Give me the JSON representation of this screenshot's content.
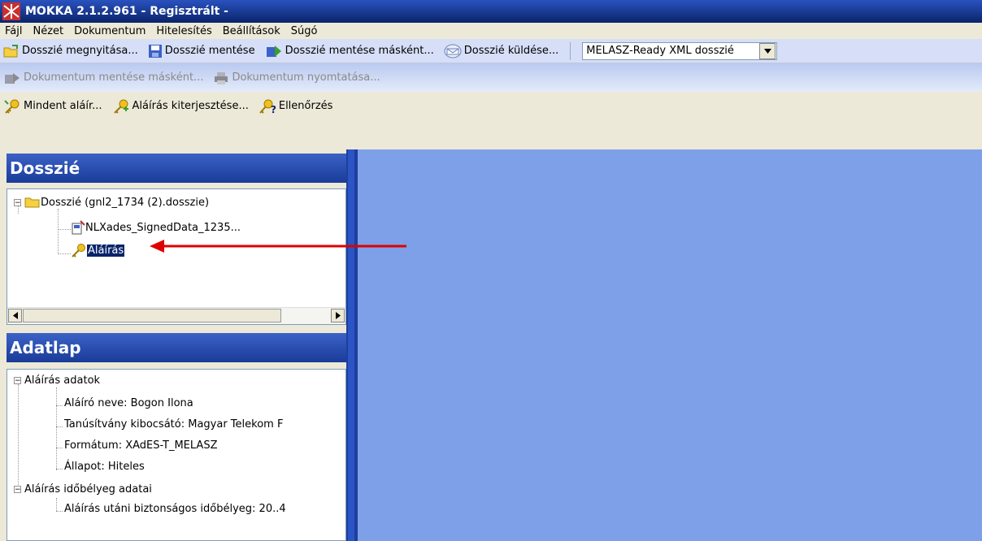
{
  "window": {
    "title": "MOKKA 2.1.2.961 - Regisztrált -"
  },
  "menu": [
    "Fájl",
    "Nézet",
    "Dokumentum",
    "Hitelesítés",
    "Beállítások",
    "Súgó"
  ],
  "toolbar1": {
    "open": "Dosszié megnyitása...",
    "save": "Dosszié mentése",
    "save_as": "Dosszié mentése másként...",
    "send": "Dosszié küldése...",
    "format_select": "MELASZ-Ready XML dosszié"
  },
  "toolbar2": {
    "doc_save_as": "Dokumentum mentése másként...",
    "doc_print": "Dokumentum nyomtatása..."
  },
  "toolbar3": {
    "sign_all": "Mindent aláír...",
    "extend_sig": "Aláírás kiterjesztése...",
    "verify": "Ellenőrzés"
  },
  "dossier_panel": {
    "title": "Dosszié",
    "root": "Dosszié (gnl2_1734 (2).dosszie)",
    "children": [
      "NLXades_SignedData_1235...",
      "Aláírás"
    ]
  },
  "datasheet_panel": {
    "title": "Adatlap",
    "group1": "Aláírás adatok",
    "group1_items": [
      "Aláíró neve: Bogon Ilona",
      "Tanúsítvány kibocsátó: Magyar Telekom F",
      "Formátum: XAdES-T_MELASZ",
      "Állapot: Hiteles"
    ],
    "group2": "Aláírás időbélyeg adatai",
    "group2_items": [
      "Aláírás utáni biztonságos időbélyeg: 20..4"
    ]
  },
  "colors": {
    "title_bar": "#0a246a",
    "panel_header": "#2a4fb8",
    "content_bg": "#7da0e8",
    "annotation_arrow": "#e00000"
  }
}
